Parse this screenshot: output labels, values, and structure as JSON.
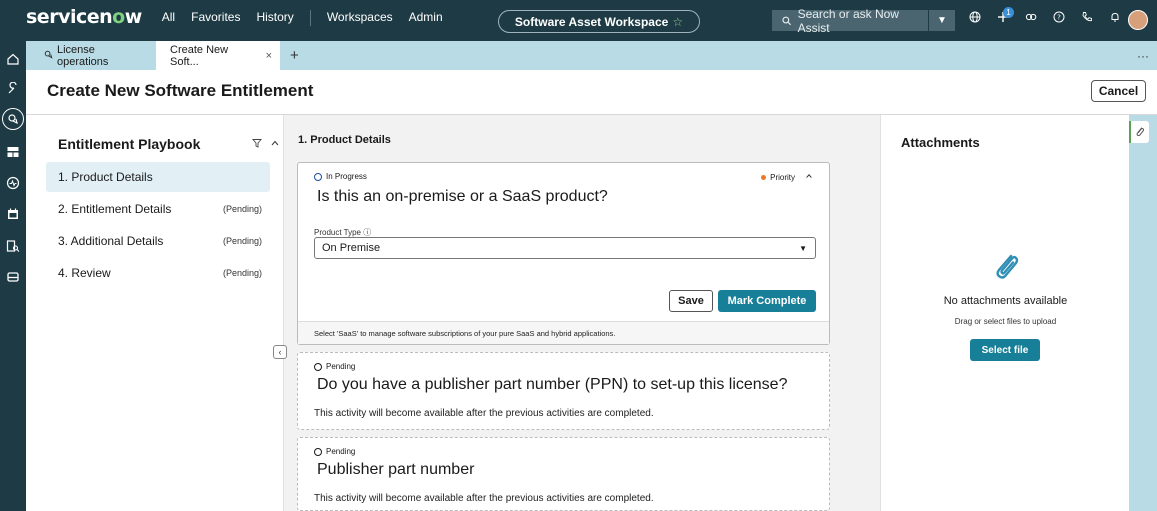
{
  "nav": {
    "logo_pre": "servicen",
    "logo_o": "o",
    "logo_post": "w",
    "links": [
      "All",
      "Favorites",
      "History",
      "Workspaces",
      "Admin"
    ],
    "workspace_title": "Software Asset Workspace",
    "search_placeholder": "Search or ask Now Assist",
    "notification_count": "1"
  },
  "tabs": {
    "first_label": "License operations",
    "active_label": "Create New Soft...",
    "close": "×",
    "add": "+",
    "more": "···"
  },
  "header": {
    "title": "Create New Software Entitlement",
    "cancel_label": "Cancel"
  },
  "playbook": {
    "title": "Entitlement Playbook",
    "items": [
      {
        "label": "1. Product Details",
        "status": ""
      },
      {
        "label": "2. Entitlement Details",
        "status": "(Pending)"
      },
      {
        "label": "3. Additional Details",
        "status": "(Pending)"
      },
      {
        "label": "4. Review",
        "status": "(Pending)"
      }
    ]
  },
  "main": {
    "step_label": "1. Product Details",
    "active_card": {
      "status": "In Progress",
      "priority": "Priority",
      "question": "Is this an on-premise or a SaaS product?",
      "field_label": "Product Type",
      "field_value": "On Premise",
      "save_label": "Save",
      "complete_label": "Mark Complete",
      "footer": "Select 'SaaS' to manage software subscriptions of your pure SaaS and hybrid applications."
    },
    "pending_cards": [
      {
        "status": "Pending",
        "question": "Do you have a publisher part number (PPN) to set-up this license?",
        "note": "This activity will become available after the previous activities are completed."
      },
      {
        "status": "Pending",
        "question": "Publisher part number",
        "note": "This activity will become available after the previous activities are completed."
      }
    ]
  },
  "attachments": {
    "title": "Attachments",
    "empty_title": "No attachments available",
    "hint": "Drag or select files to upload",
    "select_label": "Select file"
  },
  "colors": {
    "nav_bg": "#1e3b45",
    "accent": "#177f97",
    "tabbar_bg": "#b8dbe6",
    "priority_dot": "#e87a2a",
    "logo_o": "#7fd07f"
  }
}
